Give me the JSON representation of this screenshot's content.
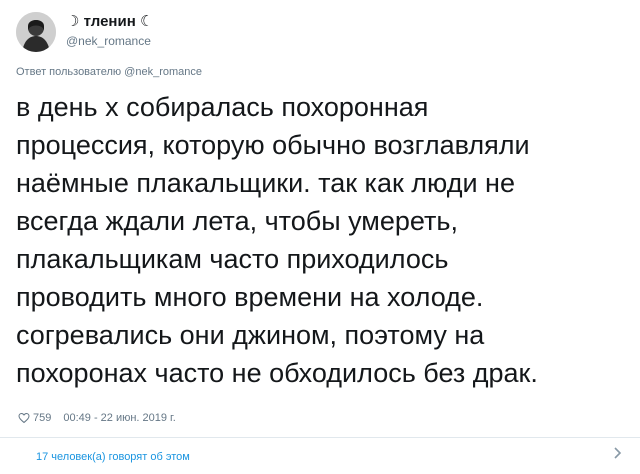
{
  "user": {
    "display_name": "☽ тленин ☾",
    "handle": "@nek_romance",
    "avatar_icon": "profile-photo"
  },
  "reply_to": "Ответ пользователю @nek_romance",
  "tweet_lines": [
    "в день х собиралась похоронная",
    "процессия, которую обычно возглавляли",
    "наёмные плакальщики. так как люди не",
    "всегда ждали лета, чтобы умереть,",
    "плакальщикам часто приходилось",
    "проводить много времени на холоде.",
    "согревались они джином, поэтому на",
    "похоронах часто не обходилось без драк."
  ],
  "meta": {
    "likes": "759",
    "timestamp": "00:49 - 22 июн. 2019 г."
  },
  "footer": {
    "people_talking": "17 человек(а) говорят об этом"
  },
  "colors": {
    "link": "#1b95e0",
    "secondary_text": "#657786",
    "primary_text": "#14171a",
    "divider": "#e1e8ed"
  }
}
